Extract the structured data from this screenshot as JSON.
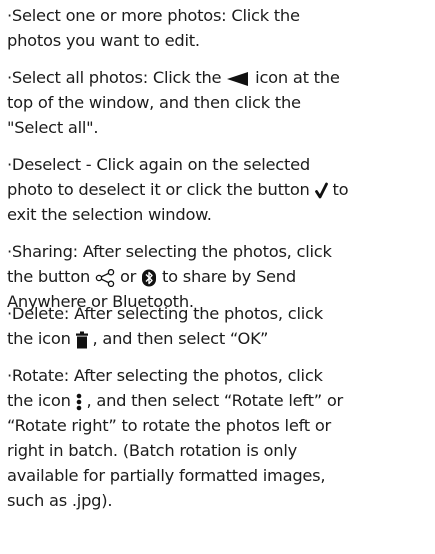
{
  "instructions": [
    {
      "lines": [
        [
          "·Select one or more photos: Click the"
        ],
        [
          "photos you want to edit."
        ]
      ]
    },
    {
      "lines": [
        [
          "·Select all photos: Click the ",
          {
            "icon": "back-triangle-icon"
          },
          " icon at the"
        ],
        [
          "top of the window, and then click the"
        ],
        [
          "\"Select all\"."
        ]
      ]
    },
    {
      "lines": [
        [
          "·Deselect - Click again on the selected"
        ],
        [
          "photo to deselect it or click the button ",
          {
            "icon": "checkmark-icon"
          },
          " to"
        ],
        [
          "exit the selection window."
        ]
      ]
    },
    {
      "lines": [
        [
          "·Sharing: After selecting the photos, click"
        ],
        [
          "the button ",
          {
            "icon": "share-icon"
          },
          " or ",
          {
            "icon": "bluetooth-icon"
          },
          " to share by Send"
        ],
        [
          "Anywhere or Bluetooth."
        ]
      ]
    },
    {
      "lines": [
        [
          "·Delete: After selecting the photos, click"
        ],
        [
          "the icon ",
          {
            "icon": "trash-icon"
          },
          " , and then select “OK”"
        ]
      ]
    },
    {
      "lines": [
        [
          "·Rotate: After selecting the photos, click"
        ],
        [
          "the icon ",
          {
            "icon": "more-vertical-icon"
          },
          " , and then select “Rotate left” or"
        ],
        [
          "“Rotate right” to rotate the photos left or"
        ],
        [
          "right in batch. (Batch rotation is only"
        ],
        [
          "available for partially formatted images,"
        ],
        [
          "such as .jpg)."
        ]
      ]
    }
  ]
}
